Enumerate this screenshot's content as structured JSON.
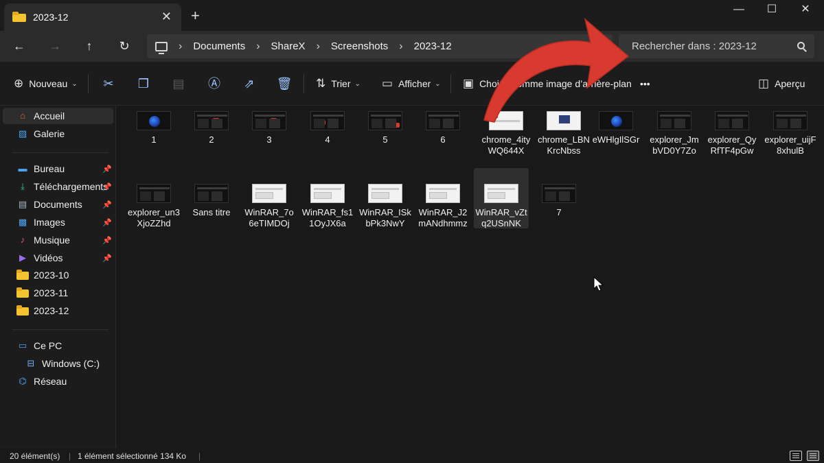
{
  "window": {
    "tab_title": "2023-12",
    "tab_close": "✕",
    "new_tab": "+",
    "minimize": "—",
    "maximize": "☐",
    "close": "✕"
  },
  "nav": {
    "back": "←",
    "forward": "→",
    "up": "↑",
    "refresh": "↻"
  },
  "breadcrumb": [
    "Documents",
    "ShareX",
    "Screenshots",
    "2023-12"
  ],
  "breadcrumb_sep": "›",
  "search": {
    "placeholder": "Rechercher dans : 2023-12",
    "value": ""
  },
  "toolbar": {
    "new_label": "Nouveau",
    "sort_label": "Trier",
    "view_label": "Afficher",
    "background_label": "Choisir comme image d’arrière-plan",
    "more_label": "•••",
    "preview_label": "Aperçu",
    "chevron": "⌄"
  },
  "sidebar": {
    "items": [
      {
        "label": "Accueil",
        "icon": "home-icon"
      },
      {
        "label": "Galerie",
        "icon": "gallery-icon"
      },
      {
        "label": "Bureau",
        "icon": "desktop-icon",
        "pinned": true
      },
      {
        "label": "Téléchargements",
        "icon": "download-icon",
        "pinned": true
      },
      {
        "label": "Documents",
        "icon": "documents-icon",
        "pinned": true
      },
      {
        "label": "Images",
        "icon": "pictures-icon",
        "pinned": true
      },
      {
        "label": "Musique",
        "icon": "music-icon",
        "pinned": true
      },
      {
        "label": "Vidéos",
        "icon": "videos-icon",
        "pinned": true
      },
      {
        "label": "2023-10",
        "icon": "folder-icon"
      },
      {
        "label": "2023-11",
        "icon": "folder-icon"
      },
      {
        "label": "2023-12",
        "icon": "folder-icon"
      },
      {
        "label": "Ce PC",
        "icon": "this-pc-icon"
      },
      {
        "label": "Windows (C:)",
        "icon": "drive-icon"
      },
      {
        "label": "Réseau",
        "icon": "network-icon"
      }
    ]
  },
  "files": [
    {
      "name": "1",
      "thumb": "globe"
    },
    {
      "name": "2",
      "thumb": "dark-red"
    },
    {
      "name": "3",
      "thumb": "dark-red"
    },
    {
      "name": "4",
      "thumb": "dark-red"
    },
    {
      "name": "5",
      "thumb": "dark-red"
    },
    {
      "name": "6",
      "thumb": "dark"
    },
    {
      "name": "chrome_4ityWQ644X",
      "thumb": "white-red"
    },
    {
      "name": "chrome_LBNKrcNbss",
      "thumb": "white-pic"
    },
    {
      "name": "eWHlgIlSGr",
      "thumb": "globe"
    },
    {
      "name": "explorer_JmbVD0Y7Zo",
      "thumb": "dark"
    },
    {
      "name": "explorer_QyRfTF4pGw",
      "thumb": "dark"
    },
    {
      "name": "explorer_uijF8xhulB",
      "thumb": "dark"
    },
    {
      "name": "explorer_un3XjoZZhd",
      "thumb": "dark"
    },
    {
      "name": "Sans titre",
      "thumb": "dark"
    },
    {
      "name": "WinRAR_7o6eTIMDOj",
      "thumb": "white"
    },
    {
      "name": "WinRAR_fs11OyJX6a",
      "thumb": "white"
    },
    {
      "name": "WinRAR_ISkbPk3NwY",
      "thumb": "white"
    },
    {
      "name": "WinRAR_J2mANdhmmz",
      "thumb": "white"
    },
    {
      "name": "WinRAR_vZtq2USnNK",
      "thumb": "white",
      "selected": true
    },
    {
      "name": "7",
      "thumb": "dark-red"
    }
  ],
  "status": {
    "count": "20 élément(s)",
    "selection": "1 élément sélectionné  134 Ko"
  },
  "colors": {
    "accent": "#9dc4ff",
    "folder": "#f4c430",
    "arrow": "#d93a2f"
  }
}
